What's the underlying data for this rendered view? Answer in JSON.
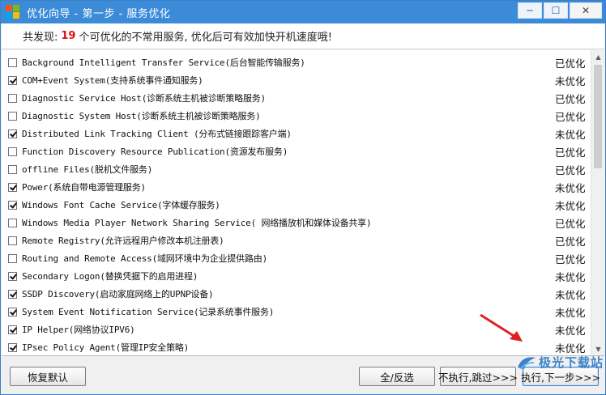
{
  "window": {
    "title": "优化向导 - 第一步 - 服务优化",
    "minimize_glyph": "─",
    "maximize_glyph": "☐",
    "close_glyph": "✕"
  },
  "header": {
    "prefix": "共发现:",
    "count": "19",
    "suffix": "个可优化的不常用服务, 优化后可有效加快开机速度哦!"
  },
  "services": [
    {
      "name": "Background Intelligent Transfer Service(后台智能传输服务)",
      "status": "已优化",
      "checked": false
    },
    {
      "name": "COM+Event System(支持系统事件通知服务)",
      "status": "未优化",
      "checked": true
    },
    {
      "name": "Diagnostic Service Host(诊断系统主机被诊断策略服务)",
      "status": "已优化",
      "checked": false
    },
    {
      "name": "Diagnostic System Host(诊断系统主机被诊断策略服务)",
      "status": "已优化",
      "checked": false
    },
    {
      "name": "Distributed Link Tracking Client (分布式链接跟踪客户端)",
      "status": "未优化",
      "checked": true
    },
    {
      "name": "Function Discovery Resource Publication(资源发布服务)",
      "status": "已优化",
      "checked": false
    },
    {
      "name": "offline Files(脱机文件服务)",
      "status": "已优化",
      "checked": false
    },
    {
      "name": "Power(系统自带电源管理服务)",
      "status": "未优化",
      "checked": true
    },
    {
      "name": "Windows Font Cache Service(字体缓存服务)",
      "status": "未优化",
      "checked": true
    },
    {
      "name": "Windows Media Player Network Sharing Service( 网络播放机和媒体设备共享)",
      "status": "已优化",
      "checked": false
    },
    {
      "name": "Remote Registry(允许远程用户修改本机注册表)",
      "status": "已优化",
      "checked": false
    },
    {
      "name": "Routing and Remote Access(域网环境中为企业提供路由)",
      "status": "已优化",
      "checked": false
    },
    {
      "name": "Secondary Logon(替换凭据下的启用进程)",
      "status": "未优化",
      "checked": true
    },
    {
      "name": "SSDP Discovery(启动家庭网络上的UPNP设备)",
      "status": "未优化",
      "checked": true
    },
    {
      "name": "System Event Notification Service(记录系统事件服务)",
      "status": "未优化",
      "checked": true
    },
    {
      "name": "IP Helper(网络协议IPV6)",
      "status": "未优化",
      "checked": true
    },
    {
      "name": "IPsec Policy Agent(管理IP安全策略)",
      "status": "未优化",
      "checked": true
    }
  ],
  "scrollbar": {
    "up_glyph": "▲",
    "down_glyph": "▼"
  },
  "buttons": {
    "restore": "恢复默认",
    "select_all": "全/反选",
    "skip": "不执行,跳过>>>",
    "next": "执行,下一步>>>"
  },
  "watermark": {
    "text": "极光下载站"
  },
  "colors": {
    "titlebar": "#3b8bd9",
    "count_red": "#e01010",
    "annotation_arrow": "#e02020"
  }
}
